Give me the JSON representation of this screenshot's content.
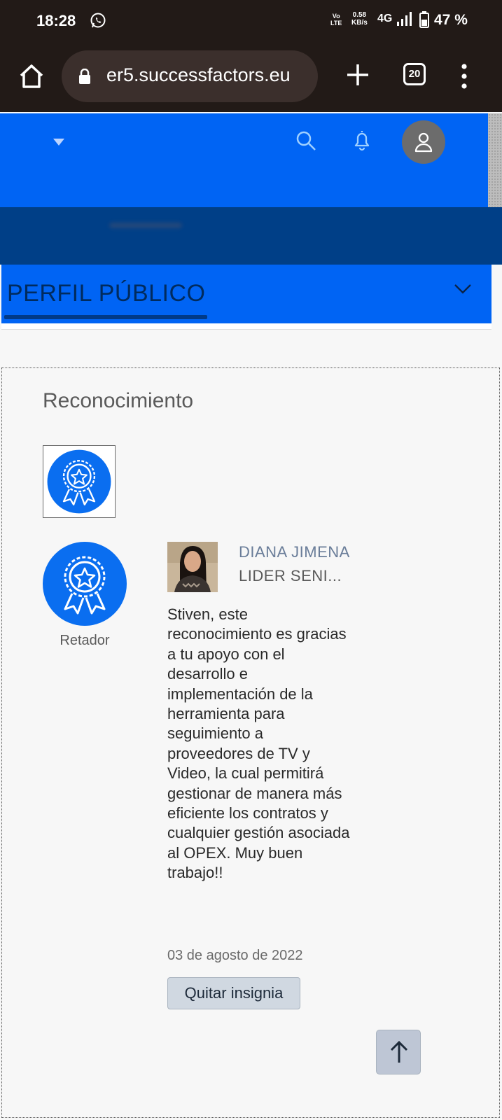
{
  "status_bar": {
    "time": "18:28",
    "volte_line1": "Vo",
    "volte_line2": "LTE",
    "speed_value": "0.58",
    "speed_unit": "KB/s",
    "network": "4G",
    "battery": "47 %"
  },
  "browser": {
    "url": "er5.successfactors.eu",
    "tab_count": "20"
  },
  "nav": {
    "title": "PERFIL PÚBLICO"
  },
  "section": {
    "title": "Reconocimiento",
    "badge_name": "Retador",
    "giver_name": "DIANA JIMENA",
    "giver_role": "LIDER SENI...",
    "message": "Stiven, este reconocimiento es gracias a tu apoyo con el desarrollo e implementación de la herramienta para seguimiento a proveedores de TV y Video, la cual permitirá gestionar de manera más eficiente los contratos y cualquier gestión asociada al OPEX. Muy buen trabajo!!",
    "date": "03 de agosto de 2022",
    "remove_button": "Quitar insignia"
  },
  "colors": {
    "header_blue": "#0064f4",
    "dark_blue": "#003f87",
    "browser_dark": "#221a17"
  }
}
